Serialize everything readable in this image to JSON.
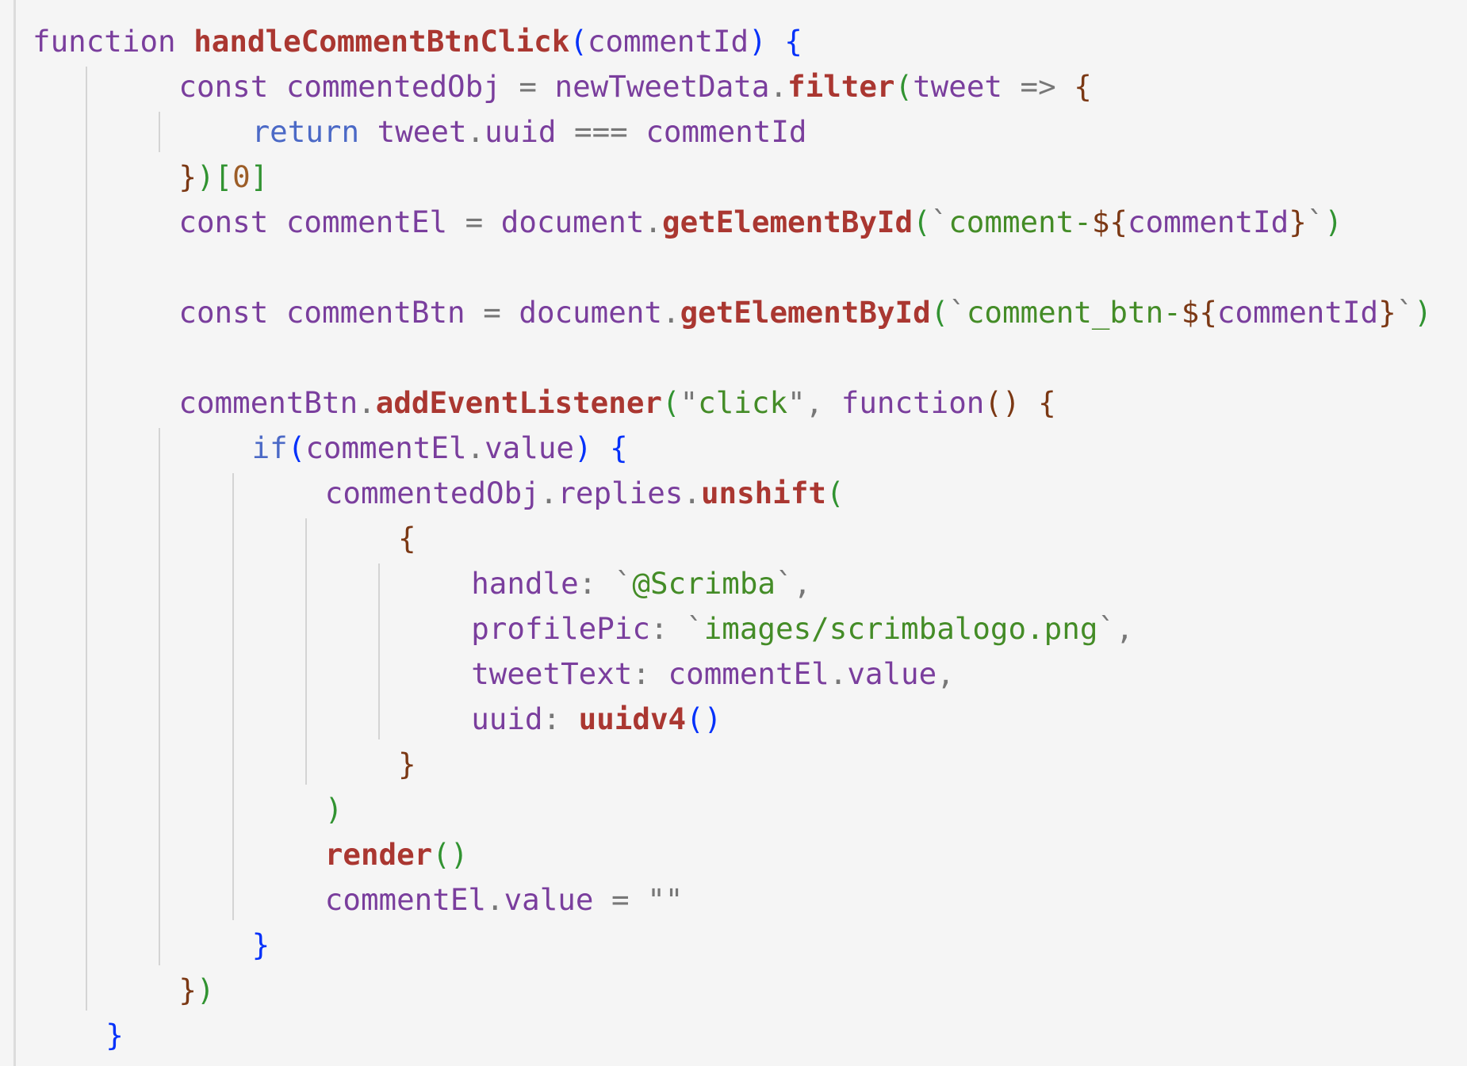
{
  "editor": {
    "language": "javascript",
    "lines": [
      {
        "indent": 0,
        "tokens": [
          {
            "t": "function",
            "c": "kw"
          },
          {
            "t": " ",
            "c": "op"
          },
          {
            "t": "handleCommentBtnClick",
            "c": "fn"
          },
          {
            "t": "(",
            "c": "b1"
          },
          {
            "t": "commentId",
            "c": "id"
          },
          {
            "t": ")",
            "c": "b1"
          },
          {
            "t": " ",
            "c": "op"
          },
          {
            "t": "{",
            "c": "b1"
          }
        ]
      },
      {
        "indent": 2,
        "tokens": [
          {
            "t": "const",
            "c": "kw"
          },
          {
            "t": " ",
            "c": "op"
          },
          {
            "t": "commentedObj",
            "c": "id"
          },
          {
            "t": " = ",
            "c": "op"
          },
          {
            "t": "newTweetData",
            "c": "id"
          },
          {
            "t": ".",
            "c": "op"
          },
          {
            "t": "filter",
            "c": "fn"
          },
          {
            "t": "(",
            "c": "b2"
          },
          {
            "t": "tweet",
            "c": "id"
          },
          {
            "t": " => ",
            "c": "op"
          },
          {
            "t": "{",
            "c": "b3"
          }
        ]
      },
      {
        "indent": 3,
        "tokens": [
          {
            "t": "return",
            "c": "kw-blue"
          },
          {
            "t": " ",
            "c": "op"
          },
          {
            "t": "tweet",
            "c": "id"
          },
          {
            "t": ".",
            "c": "op"
          },
          {
            "t": "uuid",
            "c": "id"
          },
          {
            "t": " === ",
            "c": "op"
          },
          {
            "t": "commentId",
            "c": "id"
          }
        ]
      },
      {
        "indent": 2,
        "tokens": [
          {
            "t": "}",
            "c": "b3"
          },
          {
            "t": ")",
            "c": "b2"
          },
          {
            "t": "[",
            "c": "b2"
          },
          {
            "t": "0",
            "c": "num"
          },
          {
            "t": "]",
            "c": "b2"
          }
        ]
      },
      {
        "indent": 2,
        "tokens": [
          {
            "t": "const",
            "c": "kw"
          },
          {
            "t": " ",
            "c": "op"
          },
          {
            "t": "commentEl",
            "c": "id"
          },
          {
            "t": " = ",
            "c": "op"
          },
          {
            "t": "document",
            "c": "id"
          },
          {
            "t": ".",
            "c": "op"
          },
          {
            "t": "getElementById",
            "c": "fn"
          },
          {
            "t": "(",
            "c": "b2"
          },
          {
            "t": "`",
            "c": "op"
          },
          {
            "t": "comment-",
            "c": "str"
          },
          {
            "t": "${",
            "c": "b3"
          },
          {
            "t": "commentId",
            "c": "id"
          },
          {
            "t": "}",
            "c": "b3"
          },
          {
            "t": "`",
            "c": "op"
          },
          {
            "t": ")",
            "c": "b2"
          }
        ]
      },
      {
        "indent": 0,
        "tokens": []
      },
      {
        "indent": 2,
        "tokens": [
          {
            "t": "const",
            "c": "kw"
          },
          {
            "t": " ",
            "c": "op"
          },
          {
            "t": "commentBtn",
            "c": "id"
          },
          {
            "t": " = ",
            "c": "op"
          },
          {
            "t": "document",
            "c": "id"
          },
          {
            "t": ".",
            "c": "op"
          },
          {
            "t": "getElementById",
            "c": "fn"
          },
          {
            "t": "(",
            "c": "b2"
          },
          {
            "t": "`",
            "c": "op"
          },
          {
            "t": "comment_btn-",
            "c": "str"
          },
          {
            "t": "${",
            "c": "b3"
          },
          {
            "t": "commentId",
            "c": "id"
          },
          {
            "t": "}",
            "c": "b3"
          },
          {
            "t": "`",
            "c": "op"
          },
          {
            "t": ")",
            "c": "b2"
          }
        ]
      },
      {
        "indent": 0,
        "tokens": []
      },
      {
        "indent": 2,
        "tokens": [
          {
            "t": "commentBtn",
            "c": "id"
          },
          {
            "t": ".",
            "c": "op"
          },
          {
            "t": "addEventListener",
            "c": "fn"
          },
          {
            "t": "(",
            "c": "b2"
          },
          {
            "t": "\"",
            "c": "op"
          },
          {
            "t": "click",
            "c": "str"
          },
          {
            "t": "\"",
            "c": "op"
          },
          {
            "t": ", ",
            "c": "op"
          },
          {
            "t": "function",
            "c": "kw"
          },
          {
            "t": "()",
            "c": "b3"
          },
          {
            "t": " ",
            "c": "op"
          },
          {
            "t": "{",
            "c": "b3"
          }
        ]
      },
      {
        "indent": 3,
        "tokens": [
          {
            "t": "if",
            "c": "kw-blue"
          },
          {
            "t": "(",
            "c": "b1"
          },
          {
            "t": "commentEl",
            "c": "id"
          },
          {
            "t": ".",
            "c": "op"
          },
          {
            "t": "value",
            "c": "id"
          },
          {
            "t": ")",
            "c": "b1"
          },
          {
            "t": " ",
            "c": "op"
          },
          {
            "t": "{",
            "c": "b1"
          }
        ]
      },
      {
        "indent": 4,
        "tokens": [
          {
            "t": "commentedObj",
            "c": "id"
          },
          {
            "t": ".",
            "c": "op"
          },
          {
            "t": "replies",
            "c": "id"
          },
          {
            "t": ".",
            "c": "op"
          },
          {
            "t": "unshift",
            "c": "fn"
          },
          {
            "t": "(",
            "c": "b2"
          }
        ]
      },
      {
        "indent": 5,
        "tokens": [
          {
            "t": "{",
            "c": "b3"
          }
        ]
      },
      {
        "indent": 6,
        "tokens": [
          {
            "t": "handle",
            "c": "id"
          },
          {
            "t": ": ",
            "c": "op"
          },
          {
            "t": "`",
            "c": "op"
          },
          {
            "t": "@Scrimba",
            "c": "str"
          },
          {
            "t": "`",
            "c": "op"
          },
          {
            "t": ",",
            "c": "op"
          }
        ]
      },
      {
        "indent": 6,
        "tokens": [
          {
            "t": "profilePic",
            "c": "id"
          },
          {
            "t": ": ",
            "c": "op"
          },
          {
            "t": "`",
            "c": "op"
          },
          {
            "t": "images/scrimbalogo.png",
            "c": "str"
          },
          {
            "t": "`",
            "c": "op"
          },
          {
            "t": ",",
            "c": "op"
          }
        ]
      },
      {
        "indent": 6,
        "tokens": [
          {
            "t": "tweetText",
            "c": "id"
          },
          {
            "t": ": ",
            "c": "op"
          },
          {
            "t": "commentEl",
            "c": "id"
          },
          {
            "t": ".",
            "c": "op"
          },
          {
            "t": "value",
            "c": "id"
          },
          {
            "t": ",",
            "c": "op"
          }
        ]
      },
      {
        "indent": 6,
        "tokens": [
          {
            "t": "uuid",
            "c": "id"
          },
          {
            "t": ": ",
            "c": "op"
          },
          {
            "t": "uuidv4",
            "c": "fn"
          },
          {
            "t": "()",
            "c": "b1"
          }
        ]
      },
      {
        "indent": 5,
        "tokens": [
          {
            "t": "}",
            "c": "b3"
          }
        ]
      },
      {
        "indent": 4,
        "tokens": [
          {
            "t": ")",
            "c": "b2"
          }
        ]
      },
      {
        "indent": 4,
        "tokens": [
          {
            "t": "render",
            "c": "fn"
          },
          {
            "t": "()",
            "c": "b2"
          }
        ]
      },
      {
        "indent": 4,
        "tokens": [
          {
            "t": "commentEl",
            "c": "id"
          },
          {
            "t": ".",
            "c": "op"
          },
          {
            "t": "value",
            "c": "id"
          },
          {
            "t": " = ",
            "c": "op"
          },
          {
            "t": "\"\"",
            "c": "op"
          }
        ]
      },
      {
        "indent": 3,
        "tokens": [
          {
            "t": "}",
            "c": "b1"
          }
        ]
      },
      {
        "indent": 2,
        "tokens": [
          {
            "t": "}",
            "c": "b3"
          },
          {
            "t": ")",
            "c": "b2"
          }
        ]
      },
      {
        "indent": 1,
        "tokens": [
          {
            "t": "}",
            "c": "b1"
          }
        ]
      }
    ]
  }
}
